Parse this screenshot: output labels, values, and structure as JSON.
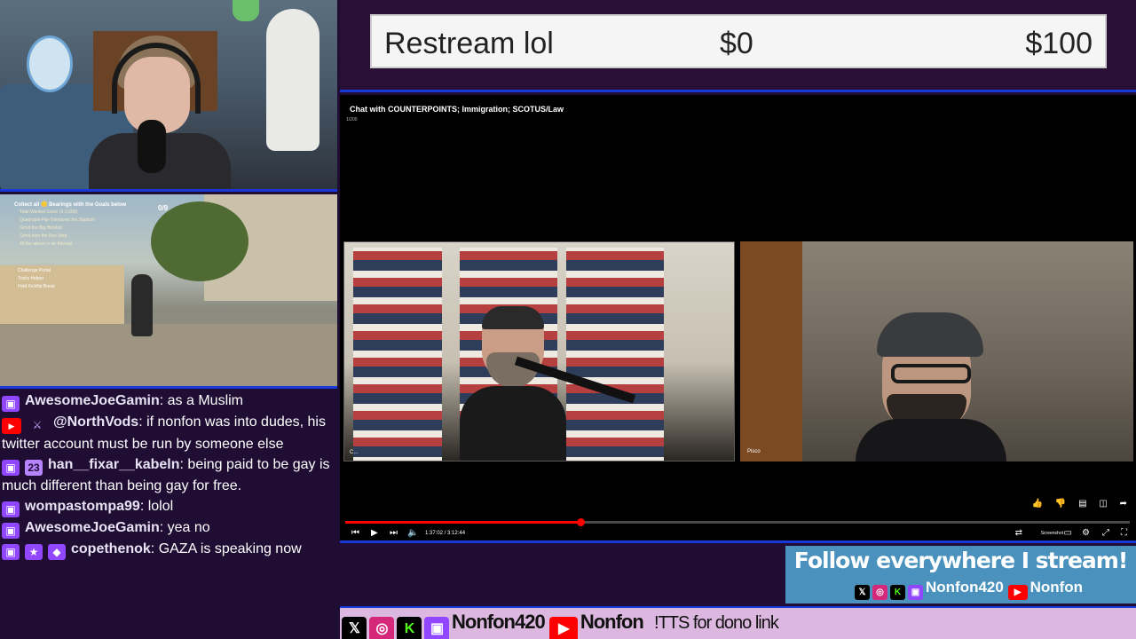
{
  "donation": {
    "title": "Restream lol",
    "min": "$0",
    "max": "$100"
  },
  "game": {
    "hud_title": "Collect all 🪙 Bearings with the Goals below",
    "hud_count": "0/9",
    "objectives": [
      "Total Wanted Score (0-2,000)",
      "Quadruple Flip-Takedown the Stadium",
      "Grind the Big Hotshot",
      "Grind over the Bus Stop",
      "All the above in an Attempt"
    ],
    "sub_lines": [
      "Challenge Portal",
      "Tricks Helper",
      "Hold Kickflip  Boost"
    ]
  },
  "chat": [
    {
      "badges": [
        "twitch"
      ],
      "user": "AwesomeJoeGamin",
      "text": "as a Muslim"
    },
    {
      "badges": [
        "youtube",
        "mod"
      ],
      "user": "@NorthVods",
      "text": "if nonfon was into dudes, his twitter account must be run by someone else"
    },
    {
      "badges": [
        "twitch",
        "sub"
      ],
      "user": "han__fixar__kabeln",
      "text": "being paid to be gay is much different than being gay for free."
    },
    {
      "badges": [
        "twitch"
      ],
      "user": "wompastompa99",
      "text": "lolol"
    },
    {
      "badges": [
        "twitch"
      ],
      "user": "AwesomeJoeGamin",
      "text": "yea no"
    },
    {
      "badges": [
        "twitch",
        "star",
        "gem"
      ],
      "user": "copethenok",
      "text": "GAZA is speaking now"
    }
  ],
  "badge_glyphs": {
    "twitch": "▣",
    "youtube": "▶",
    "mod": "⚔",
    "sub": "23",
    "star": "★",
    "gem": "◆"
  },
  "player": {
    "title": "Chat with COUNTERPOINTS; Immigration; SCOTUS/Law",
    "page": "1/200",
    "left_label": "C...",
    "right_label": "Pisco",
    "time": "1:37:02 / 3:12:44",
    "progress_fraction": 0.3,
    "screenshot_label": "Screenshot"
  },
  "follow": {
    "title": "Follow everywhere I stream!",
    "twitch_name": "Nonfon420",
    "youtube_name": "Nonfon"
  },
  "ticker": {
    "twitch_name": "Nonfon420",
    "youtube_name": "Nonfon",
    "text": "!TTS for dono link"
  },
  "colors": {
    "accent_border": "#1838d8",
    "background": "#1f0d33",
    "follow_bg": "#4a92bd",
    "ticker_bg": "#dcb7df",
    "twitch": "#9146ff",
    "youtube": "#ff0000"
  }
}
